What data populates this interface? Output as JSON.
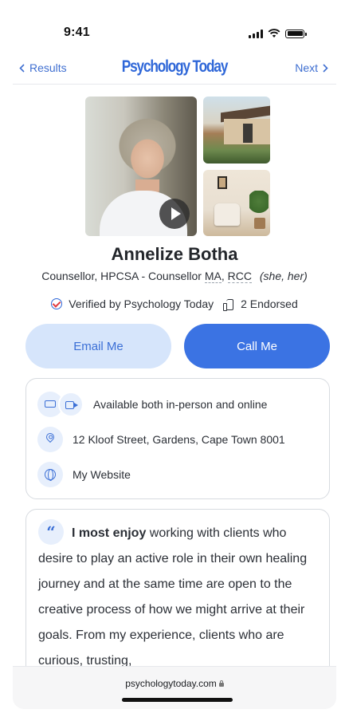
{
  "status_bar": {
    "time": "9:41"
  },
  "nav": {
    "back_label": "Results",
    "next_label": "Next",
    "logo_text": "Psychology Today"
  },
  "profile": {
    "name": "Annelize Botha",
    "credentials_prefix": "Counsellor, HPCSA - Counsellor",
    "credential_ma": "MA",
    "credential_rcc": "RCC",
    "pronouns": "(she, her)",
    "verified_text": "Verified by Psychology Today",
    "endorsed_text": "2 Endorsed"
  },
  "actions": {
    "email_label": "Email Me",
    "call_label": "Call Me"
  },
  "info": {
    "availability": "Available both in-person and online",
    "address": "12 Kloof Street, Gardens, Cape Town 8001",
    "website": "My Website"
  },
  "about": {
    "bold_lead": "I most enjoy",
    "text": " working with clients who desire to play an active role in their own healing journey and at the same time are open to the creative process of how we might arrive at their goals. From my experience, clients who are curious, trusting,"
  },
  "browser": {
    "url": "psychologytoday.com"
  },
  "colors": {
    "accent": "#3b73e3",
    "accent_light": "#d6e5fb",
    "link": "#3f6fd1"
  }
}
